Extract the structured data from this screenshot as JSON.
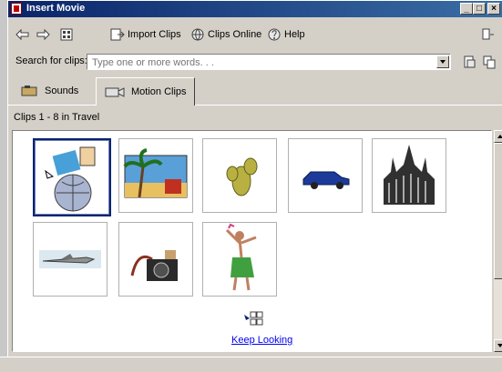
{
  "window": {
    "title": "Insert Movie"
  },
  "title_buttons": {
    "minimize": "_",
    "maximize": "□",
    "close": "×"
  },
  "toolbar": {
    "back_icon": "back-arrow-icon",
    "forward_icon": "forward-arrow-icon",
    "all_categories_icon": "all-categories-icon",
    "import_label": "Import Clips",
    "online_label": "Clips Online",
    "help_label": "Help"
  },
  "search": {
    "label": "Search for clips:",
    "placeholder": "Type one or more words. . ."
  },
  "tabs": [
    {
      "label": "Sounds",
      "active": false
    },
    {
      "label": "Motion Clips",
      "active": true
    }
  ],
  "status": "Clips 1 - 8 in Travel",
  "clips": [
    {
      "name": "travel-globe-clip",
      "selected": true
    },
    {
      "name": "beach-palm-clip",
      "selected": false
    },
    {
      "name": "cactus-clip",
      "selected": false
    },
    {
      "name": "car-clip",
      "selected": false
    },
    {
      "name": "cathedral-clip",
      "selected": false
    },
    {
      "name": "airplane-clip",
      "selected": false
    },
    {
      "name": "camera-clip",
      "selected": false
    },
    {
      "name": "hula-dancer-clip",
      "selected": false
    }
  ],
  "keep_looking": "Keep Looking",
  "colors": {
    "titlebar": "#0a246a",
    "selection": "#0a246a",
    "link": "#0000ee"
  }
}
